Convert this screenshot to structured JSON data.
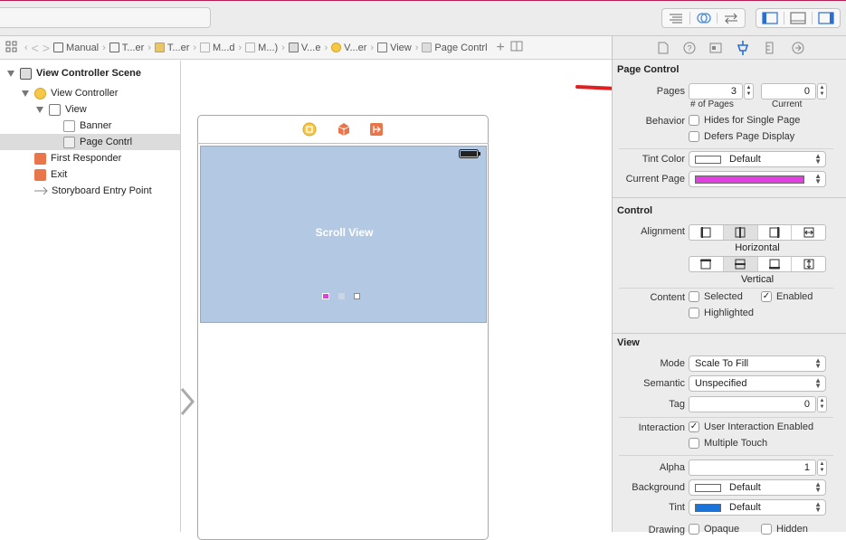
{
  "jumpbar": {
    "crumbs": [
      "Manual",
      "T...er",
      "T...er",
      "M...d",
      "M...)",
      "V...e",
      "V...er",
      "View",
      "Page Contrl"
    ]
  },
  "outline": {
    "items": [
      {
        "label": "View Controller Scene",
        "bold": true
      },
      {
        "label": "View Controller"
      },
      {
        "label": "View"
      },
      {
        "label": "Banner"
      },
      {
        "label": "Page Contrl",
        "selected": true
      },
      {
        "label": "First Responder"
      },
      {
        "label": "Exit"
      },
      {
        "label": "Storyboard Entry Point"
      }
    ]
  },
  "canvas": {
    "scroll_label": "Scroll View"
  },
  "inspector": {
    "page_control": {
      "title": "Page Control",
      "pages_label": "Pages",
      "pages_value": "3",
      "pages_caption": "# of Pages",
      "current_value": "0",
      "current_caption": "Current",
      "behavior_label": "Behavior",
      "hides_single": "Hides for Single Page",
      "defers_display": "Defers Page Display",
      "tint_label": "Tint Color",
      "tint_value": "Default",
      "current_page_label": "Current Page"
    },
    "control": {
      "title": "Control",
      "alignment_label": "Alignment",
      "horizontal_caption": "Horizontal",
      "vertical_caption": "Vertical",
      "content_label": "Content",
      "selected": "Selected",
      "enabled": "Enabled",
      "highlighted": "Highlighted"
    },
    "view": {
      "title": "View",
      "mode_label": "Mode",
      "mode_value": "Scale To Fill",
      "semantic_label": "Semantic",
      "semantic_value": "Unspecified",
      "tag_label": "Tag",
      "tag_value": "0",
      "interaction_label": "Interaction",
      "user_interaction": "User Interaction Enabled",
      "multiple_touch": "Multiple Touch",
      "alpha_label": "Alpha",
      "alpha_value": "1",
      "background_label": "Background",
      "background_value": "Default",
      "tint_label": "Tint",
      "tint_value": "Default",
      "drawing_label": "Drawing",
      "opaque": "Opaque",
      "hidden": "Hidden"
    }
  },
  "colors": {
    "scroll_bg": "#b3c9e3",
    "current_page_color": "#e040e0",
    "tint_blue": "#1a73d9",
    "arrow_red": "#e02020"
  }
}
